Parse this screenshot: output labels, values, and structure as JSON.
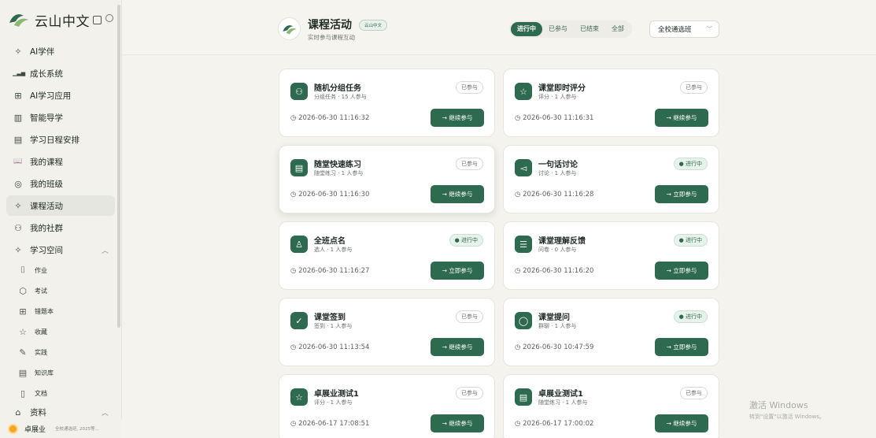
{
  "brand": {
    "name": "云山中文"
  },
  "sidebar": {
    "items": [
      {
        "label": "AI学伴",
        "icon": "✧"
      },
      {
        "label": "成长系统",
        "icon": "▁▃▅"
      },
      {
        "label": "AI学习应用",
        "icon": "⊞"
      },
      {
        "label": "智能导学",
        "icon": "▥"
      },
      {
        "label": "学习日程安排",
        "icon": "▤"
      },
      {
        "label": "我的课程",
        "icon": "📖"
      },
      {
        "label": "我的班级",
        "icon": "◎"
      },
      {
        "label": "课程活动",
        "icon": "✧"
      },
      {
        "label": "我的社群",
        "icon": "⚇"
      },
      {
        "label": "学习空间",
        "icon": "✧"
      }
    ],
    "sub_items": [
      {
        "label": "作业",
        "icon": "⌷"
      },
      {
        "label": "考试",
        "icon": "⬡"
      },
      {
        "label": "错题本",
        "icon": "⊞"
      },
      {
        "label": "收藏",
        "icon": "☆"
      },
      {
        "label": "实践",
        "icon": "✎"
      },
      {
        "label": "知识库",
        "icon": "▤"
      },
      {
        "label": "文档",
        "icon": "▯"
      }
    ],
    "resources_label": "资料",
    "chevron_up": "︿",
    "user": {
      "name": "卓展业",
      "subtitle": "全校通选班, 2025等..."
    }
  },
  "header": {
    "title": "课程活动",
    "badge": "云山中文",
    "subtitle": "实时参与课程互动",
    "filters": [
      "进行中",
      "已参与",
      "已结束",
      "全部"
    ],
    "selected_class": "全校通选班",
    "chevron": "﹀"
  },
  "cards": [
    {
      "title": "随机分组任务",
      "meta": "分组任务 · 15 人参与",
      "status": "已参与",
      "time": "2026-06-30 11:16:32",
      "button": "→  继续参与",
      "icon": "⚇"
    },
    {
      "title": "课堂即时评分",
      "meta": "评分 · 1 人参与",
      "status": "已参与",
      "time": "2026-06-30 11:16:31",
      "button": "→  继续参与",
      "icon": "☆"
    },
    {
      "title": "随堂快速练习",
      "meta": "随堂练习 · 1 人参与",
      "status": "已参与",
      "time": "2026-06-30 11:16:30",
      "button": "→  继续参与",
      "icon": "▤"
    },
    {
      "title": "一句话讨论",
      "meta": "讨论 · 1 人参与",
      "status": "● 进行中",
      "time": "2026-06-30 11:16:28",
      "button": "→  立即参与",
      "icon": "◅"
    },
    {
      "title": "全班点名",
      "meta": "选人 · 1 人参与",
      "status": "● 进行中",
      "time": "2026-06-30 11:16:27",
      "button": "→  立即参与",
      "icon": "♙"
    },
    {
      "title": "课堂理解反馈",
      "meta": "问卷 · 0 人参与",
      "status": "● 进行中",
      "time": "2026-06-30 11:16:20",
      "button": "→  立即参与",
      "icon": "☰"
    },
    {
      "title": "课堂签到",
      "meta": "签到 · 1 人参与",
      "status": "已参与",
      "time": "2026-06-30 11:13:54",
      "button": "→  继续参与",
      "icon": "✓"
    },
    {
      "title": "课堂提问",
      "meta": "群聊 · 1 人参与",
      "status": "● 进行中",
      "time": "2026-06-30 10:47:59",
      "button": "→  立即参与",
      "icon": "◯"
    },
    {
      "title": "卓展业测试1",
      "meta": "评分 · 1 人参与",
      "status": "已参与",
      "time": "2026-06-17 17:08:51",
      "button": "→  继续参与",
      "icon": "☆"
    },
    {
      "title": "卓展业测试1",
      "meta": "随堂练习 · 1 人参与",
      "status": "已参与",
      "time": "2026-06-17 17:00:02",
      "button": "→  继续参与",
      "icon": "▤"
    }
  ],
  "clock_icon": "◷",
  "watermark": {
    "line1": "激活 Windows",
    "line2": "转到\"设置\"以激活 Windows。"
  },
  "colors": {
    "accent": "#2d6a4f",
    "background": "#f5f3ee"
  }
}
